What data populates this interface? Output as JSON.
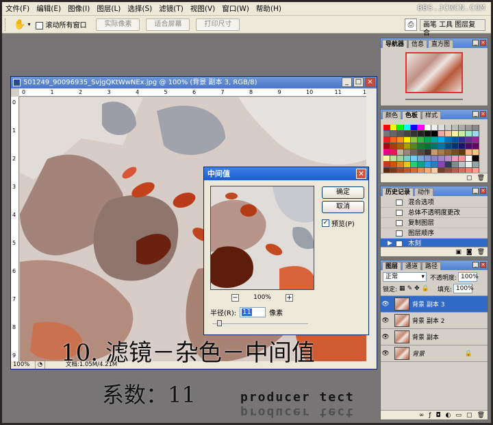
{
  "app": {
    "menus": [
      "文件(F)",
      "编辑(E)",
      "图像(I)",
      "图层(L)",
      "选择(S)",
      "滤镜(T)",
      "视图(V)",
      "窗口(W)",
      "帮助(H)"
    ],
    "watermark": "BBS.JCWCN.COM"
  },
  "options_bar": {
    "scroll_all_label": "滚动所有窗口",
    "actual_pixels": "实际像素",
    "fit_screen": "适合屏幕",
    "print_size": "打印尺寸",
    "workspace_tabs": "画笔 工具 图层复合"
  },
  "document": {
    "title": "501249_90096935_SvjgQKtWwNEx.jpg @ 100% (背景 副本 3, RGB/8)",
    "ruler_h": [
      "0",
      "1",
      "2",
      "3",
      "4",
      "5",
      "6",
      "7",
      "8",
      "9",
      "10",
      "11",
      "12"
    ],
    "ruler_v": [
      "0",
      "1",
      "2",
      "3",
      "4",
      "5",
      "6",
      "7",
      "8",
      "9"
    ],
    "zoom": "100%",
    "doc_size": "文档:1.05M/4.21M"
  },
  "overlay": {
    "step": "10. 滤镜－杂色－中间值",
    "coefficient": "系数：11",
    "credit": "producer tect"
  },
  "dialog": {
    "title": "中间值",
    "ok": "确定",
    "cancel": "取消",
    "preview_label": "预览(P)",
    "zoom": "100%",
    "radius_label": "半径(R):",
    "radius_value": "11",
    "radius_unit": "像素",
    "preview_checked": true,
    "radius_slider_fraction": 0.05
  },
  "navigator": {
    "tabs": [
      "导航器",
      "信息",
      "直方图"
    ]
  },
  "color_panel": {
    "tabs": [
      "颜色",
      "色板",
      "样式"
    ]
  },
  "history": {
    "tabs": [
      "历史记录",
      "动作"
    ],
    "items": [
      "混合选项",
      "总体不透明度更改",
      "复制图层",
      "图层顺序",
      "木刻"
    ],
    "selected": "木刻"
  },
  "layers": {
    "tabs": [
      "图层",
      "通道",
      "路径"
    ],
    "blend_mode": "正常",
    "opacity_label": "不透明度:",
    "opacity": "100%",
    "lock_label": "锁定:",
    "fill_label": "填充:",
    "fill": "100%",
    "items": [
      "背景 副本 3",
      "背景 副本 2",
      "背景 副本",
      "背景"
    ],
    "selected": "背景 副本 3"
  },
  "colors": {
    "titlebar": "#4a78c8",
    "dialog_title": "#1d5bd3",
    "selection": "#316ac5",
    "accent_orange": "#c5421a"
  }
}
